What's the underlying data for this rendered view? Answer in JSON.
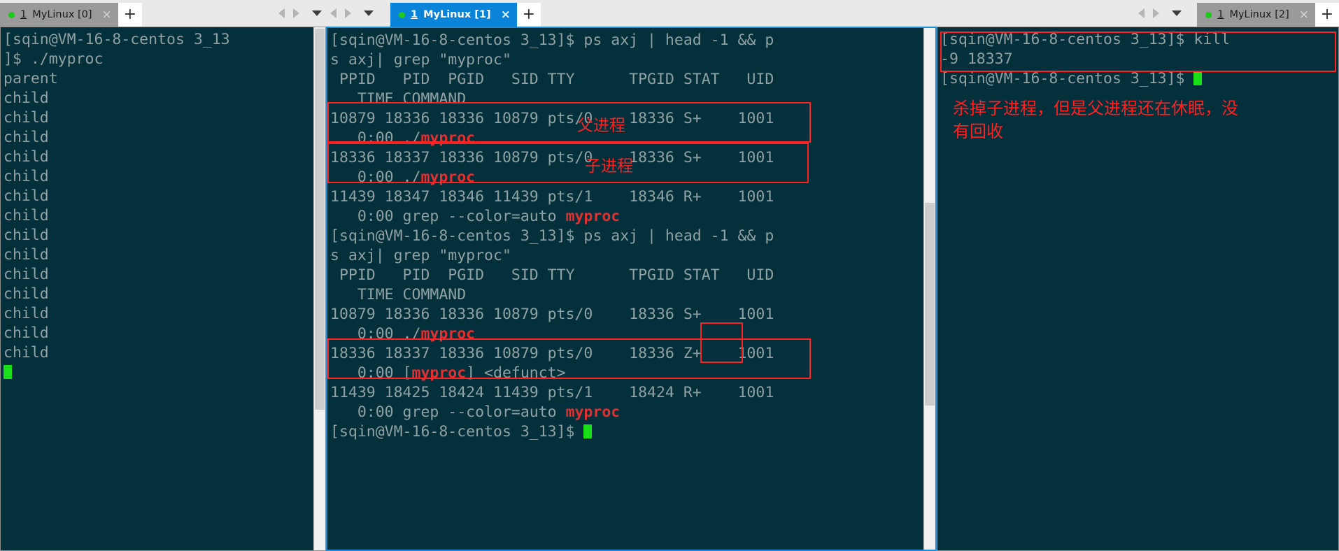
{
  "window": {
    "background_color": "#e9e9e9",
    "terminal_bg": "#04303c",
    "terminal_fg": "#8fa1a3",
    "accent_color": "#0a84d8",
    "annotation_color": "#ff2020",
    "highlight_color": "#e03030",
    "cursor_color": "#19e019"
  },
  "tabs": [
    {
      "dot": "status-dot",
      "num": "1",
      "label": " MyLinux [0]",
      "close": "×",
      "active": false,
      "name": "tab-mylinux-0"
    },
    {
      "dot": "status-dot",
      "num": "1",
      "label": " MyLinux [1]",
      "close": "×",
      "active": true,
      "name": "tab-mylinux-1"
    },
    {
      "dot": "status-dot",
      "num": "1",
      "label": " MyLinux [2]",
      "close": "×",
      "active": false,
      "name": "tab-mylinux-2"
    }
  ],
  "new_tab_label": "+",
  "panels": {
    "left": {
      "lines": [
        "[sqin@VM-16-8-centos 3_13",
        "]$ ./myproc",
        "parent",
        "child",
        "child",
        "child",
        "child",
        "child",
        "child",
        "child",
        "child",
        "child",
        "child",
        "child",
        "child",
        "child",
        "child"
      ],
      "cursor_visible": true
    },
    "middle": {
      "lines": [
        {
          "text": "[sqin@VM-16-8-centos 3_13]$ ps axj | head -1 && p"
        },
        {
          "text": "s axj| grep \"myproc\""
        },
        {
          "text": " PPID   PID  PGID   SID TTY      TPGID STAT   UID"
        },
        {
          "text": "   TIME COMMAND"
        },
        {
          "text": "10879 18336 18336 10879 pts/0    18336 S+    1001"
        },
        {
          "pre": "   0:00 ./",
          "hl": "myproc",
          "post": ""
        },
        {
          "text": "18336 18337 18336 10879 pts/0    18336 S+    1001"
        },
        {
          "pre": "   0:00 ./",
          "hl": "myproc",
          "post": ""
        },
        {
          "text": "11439 18347 18346 11439 pts/1    18346 R+    1001"
        },
        {
          "pre": "   0:00 grep --color=auto ",
          "hl": "myproc",
          "post": ""
        },
        {
          "text": "[sqin@VM-16-8-centos 3_13]$ ps axj | head -1 && p"
        },
        {
          "text": "s axj| grep \"myproc\""
        },
        {
          "text": " PPID   PID  PGID   SID TTY      TPGID STAT   UID"
        },
        {
          "text": "   TIME COMMAND"
        },
        {
          "text": "10879 18336 18336 10879 pts/0    18336 S+    1001"
        },
        {
          "pre": "   0:00 ./",
          "hl": "myproc",
          "post": ""
        },
        {
          "text": "18336 18337 18336 10879 pts/0    18336 Z+    1001"
        },
        {
          "pre": "   0:00 [",
          "hl": "myproc",
          "post": "] <defunct>"
        },
        {
          "text": "11439 18425 18424 11439 pts/1    18424 R+    1001"
        },
        {
          "pre": "   0:00 grep --color=auto ",
          "hl": "myproc",
          "post": ""
        },
        {
          "text": "[sqin@VM-16-8-centos 3_13]$ ",
          "cursor": true
        }
      ],
      "annotations": [
        {
          "name": "annotation-parent-process",
          "text": "父进程"
        },
        {
          "name": "annotation-child-process",
          "text": "子进程"
        }
      ]
    },
    "right": {
      "lines": [
        "[sqin@VM-16-8-centos 3_13]$ kill",
        "-9 18337",
        "[sqin@VM-16-8-centos 3_13]$ "
      ],
      "cursor_visible": true,
      "annotation": "杀掉子进程，但是父进程还在休眠，没\n有回收",
      "annotation_name": "annotation-kill-child-note"
    }
  }
}
